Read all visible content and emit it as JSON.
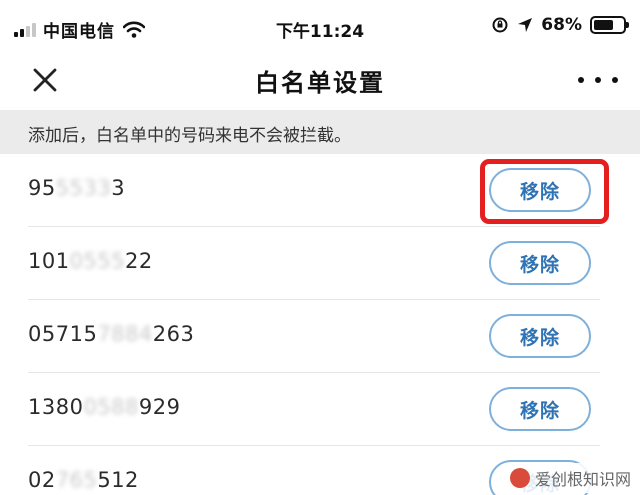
{
  "status_bar": {
    "carrier": "中国电信",
    "time": "下午11:24",
    "battery_percent": "68%",
    "battery_level": 0.68,
    "icons": [
      "signal-icon",
      "wifi-icon",
      "rotation-lock-icon",
      "location-arrow-icon",
      "battery-icon"
    ]
  },
  "nav": {
    "title": "白名单设置",
    "close_icon": "close-icon",
    "more_icon": "more-icon"
  },
  "notice": {
    "text": "添加后，白名单中的号码来电不会被拦截。"
  },
  "whitelist": {
    "remove_label": "移除",
    "rows": [
      {
        "number_start": "95",
        "number_hidden": "5533",
        "number_end": "3"
      },
      {
        "number_start": "101",
        "number_hidden": "0555",
        "number_end": "22"
      },
      {
        "number_start": "05715",
        "number_hidden": "7884",
        "number_end": "263"
      },
      {
        "number_start": "1380",
        "number_hidden": "0588",
        "number_end": "929"
      },
      {
        "number_start": "02",
        "number_hidden": "765",
        "number_end": "512"
      }
    ]
  },
  "annotation": {
    "highlight_color": "#e3201f"
  },
  "watermark": {
    "text": "爱创根知识网"
  },
  "colors": {
    "accent_blue": "#2f73b4",
    "button_border": "#7eb0dc",
    "notice_bg": "#ebebeb"
  }
}
